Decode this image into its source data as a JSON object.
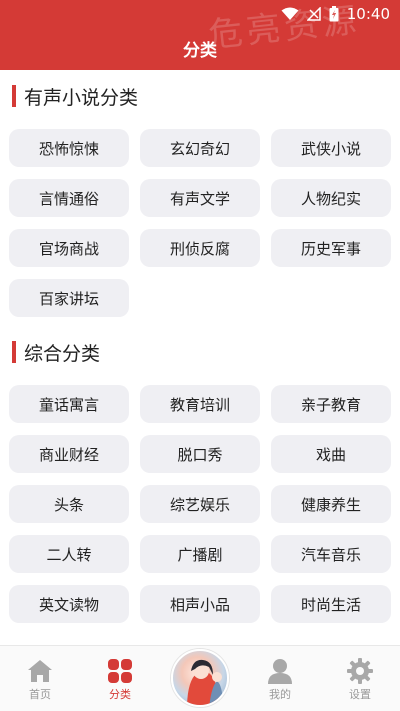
{
  "status_bar": {
    "time": "10:40"
  },
  "watermark": "危亮资源",
  "header": {
    "title": "分类"
  },
  "sections": [
    {
      "title": "有声小说分类",
      "items": [
        "恐怖惊悚",
        "玄幻奇幻",
        "武侠小说",
        "言情通俗",
        "有声文学",
        "人物纪实",
        "官场商战",
        "刑侦反腐",
        "历史军事",
        "百家讲坛"
      ]
    },
    {
      "title": "综合分类",
      "items": [
        "童话寓言",
        "教育培训",
        "亲子教育",
        "商业财经",
        "脱口秀",
        "戏曲",
        "头条",
        "综艺娱乐",
        "健康养生",
        "二人转",
        "广播剧",
        "汽车音乐",
        "英文读物",
        "相声小品",
        "时尚生活"
      ]
    }
  ],
  "bottom_nav": {
    "items": [
      {
        "label": "首页",
        "icon": "home-icon"
      },
      {
        "label": "分类",
        "icon": "grid-icon",
        "active": true
      },
      {
        "label": "",
        "icon": "avatar-image"
      },
      {
        "label": "我的",
        "icon": "user-icon"
      },
      {
        "label": "设置",
        "icon": "gear-icon"
      }
    ]
  },
  "colors": {
    "accent": "#d43a36",
    "chip_bg": "#efeff3",
    "inactive": "#999999"
  }
}
